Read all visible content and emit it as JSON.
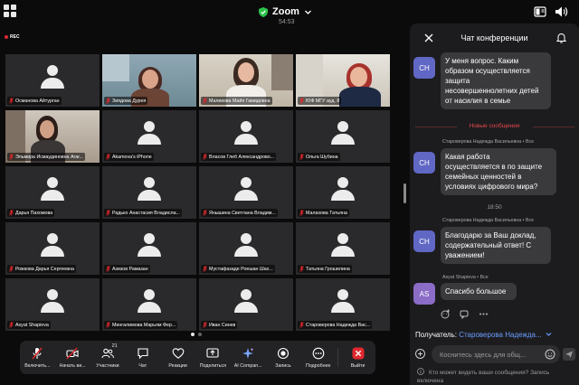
{
  "top_bar": {
    "title": "Zoom",
    "timer": "54:53",
    "rec_label": "REC"
  },
  "participants_grid": [
    {
      "name": "Османова Айтурган",
      "video": false
    },
    {
      "name": "Зиядова Дурея",
      "video": true,
      "active_speaker": true
    },
    {
      "name": "Маликова Майя Гамидовна",
      "video": true
    },
    {
      "name": "ЮФ МГУ ауд. 8",
      "video": true
    },
    {
      "name": "Эльмира Исмаудиновна Агаг...",
      "video": true
    },
    {
      "name": "Akamova's iPhone",
      "video": false
    },
    {
      "name": "Власов Глеб Александрово...",
      "video": false
    },
    {
      "name": "Ольга Шубина",
      "video": false
    },
    {
      "name": "Дарья Пахомова",
      "video": false
    },
    {
      "name": "Радько Анастасия Владисла...",
      "video": false
    },
    {
      "name": "Янышина Светлана Владим...",
      "video": false
    },
    {
      "name": "Малахова Татьяна",
      "video": false
    },
    {
      "name": "Рожкова Дарья Сергеевна",
      "video": false
    },
    {
      "name": "Азизов Рамазан",
      "video": false
    },
    {
      "name": "Мустафазаде Роешан Шах...",
      "video": false
    },
    {
      "name": "Татьяна Грошилина",
      "video": false
    },
    {
      "name": "Asyat Shapieva",
      "video": false
    },
    {
      "name": "Мингалимова Марьям Фер...",
      "video": false
    },
    {
      "name": "Иван Синев",
      "video": false
    },
    {
      "name": "Староверова Надежда Вас...",
      "video": false
    }
  ],
  "pagination": {
    "pages": 2,
    "current": 1
  },
  "toolbar": {
    "items": [
      {
        "label": "Включить...",
        "icon": "mic-muted-icon"
      },
      {
        "label": "Начать ви...",
        "icon": "video-off-icon"
      },
      {
        "label": "Участники",
        "icon": "participants-icon",
        "count": "21"
      },
      {
        "label": "Чат",
        "icon": "chat-icon"
      },
      {
        "label": "Реакции",
        "icon": "heart-icon"
      },
      {
        "label": "Поделиться",
        "icon": "share-screen-icon"
      },
      {
        "label": "AI Compan...",
        "icon": "ai-sparkle-icon"
      },
      {
        "label": "Запись",
        "icon": "record-icon"
      },
      {
        "label": "Подробнее",
        "icon": "more-icon"
      },
      {
        "label": "Выйти",
        "icon": "leave-icon"
      }
    ]
  },
  "chat": {
    "title": "Чат конференции",
    "messages": [
      {
        "avatar": "CH",
        "sender": "",
        "text_lines": [
          "У меня вопрос. Каким",
          "образом осуществляется",
          "защита",
          "несовершеннолетних детей",
          "от насилия в семье"
        ]
      },
      {
        "avatar": "CH",
        "sender": "Староверова Надежда Васильевна • Все",
        "text_lines": [
          "Какая работа",
          "осуществляется в по защите",
          "семейных ценностей в",
          "условиях цифрового мира?"
        ]
      },
      {
        "avatar": "CH",
        "sender": "Староверова Надежда Васильевна • Все",
        "text_lines": [
          "Благодарю за Ваш доклад,",
          "содержательный ответ! С",
          "уважением!"
        ]
      },
      {
        "avatar": "AS",
        "sender": "Asyat Shapieva • Все",
        "text_lines": [
          "Спасибо большое"
        ]
      }
    ],
    "new_messages_label": "Новые сообщения",
    "time_separator": "18:50",
    "recipient_label": "Получатель:",
    "recipient_value": "Староверова Надежда...",
    "input_placeholder": "Коснитесь здесь для общ...",
    "footer_note": "Кто может видеть ваши сообщения? Запись включена",
    "colors": {
      "avatar_ch": "#6067c4",
      "avatar_as": "#8b6cc7",
      "link": "#6b9cff",
      "new_messages": "#e5484d"
    }
  }
}
